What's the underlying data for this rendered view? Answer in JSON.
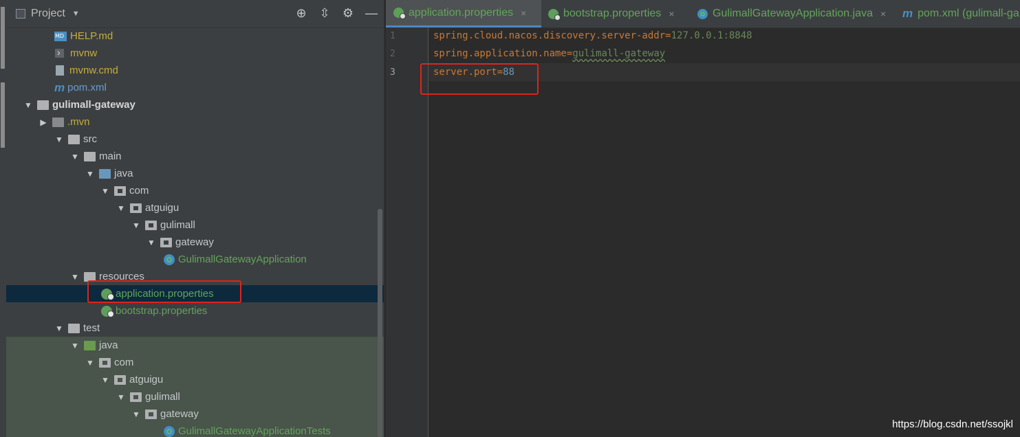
{
  "project_panel": {
    "title": "Project",
    "toolbar_icons": [
      "locate-icon",
      "collapse-icon",
      "gear-icon",
      "minimize-icon"
    ],
    "tree": [
      {
        "label": "HELP.md",
        "icon": "markdown-file-icon"
      },
      {
        "label": "mvnw",
        "icon": "script-file-icon"
      },
      {
        "label": "mvnw.cmd",
        "icon": "text-file-icon"
      },
      {
        "label": "pom.xml",
        "icon": "maven-icon"
      },
      {
        "label": "gulimall-gateway",
        "icon": "module-folder-icon"
      },
      {
        "label": ".mvn",
        "icon": "folder-icon"
      },
      {
        "label": "src",
        "icon": "folder-icon"
      },
      {
        "label": "main",
        "icon": "folder-icon"
      },
      {
        "label": "java",
        "icon": "source-folder-icon"
      },
      {
        "label": "com",
        "icon": "package-icon"
      },
      {
        "label": "atguigu",
        "icon": "package-icon"
      },
      {
        "label": "gulimall",
        "icon": "package-icon"
      },
      {
        "label": "gateway",
        "icon": "package-icon"
      },
      {
        "label": "GulimallGatewayApplication",
        "icon": "spring-boot-class-icon"
      },
      {
        "label": "resources",
        "icon": "resources-folder-icon"
      },
      {
        "label": "application.properties",
        "icon": "spring-properties-icon"
      },
      {
        "label": "bootstrap.properties",
        "icon": "spring-properties-icon"
      },
      {
        "label": "test",
        "icon": "folder-icon"
      },
      {
        "label": "java",
        "icon": "test-source-folder-icon"
      },
      {
        "label": "com",
        "icon": "package-icon"
      },
      {
        "label": "atguigu",
        "icon": "package-icon"
      },
      {
        "label": "gulimall",
        "icon": "package-icon"
      },
      {
        "label": "gateway",
        "icon": "package-icon"
      },
      {
        "label": "GulimallGatewayApplicationTests",
        "icon": "spring-boot-class-icon"
      }
    ]
  },
  "editor": {
    "tabs": [
      {
        "label": "application.properties",
        "icon": "spring-properties-icon",
        "active": true
      },
      {
        "label": "bootstrap.properties",
        "icon": "spring-properties-icon",
        "active": false
      },
      {
        "label": "GulimallGatewayApplication.java",
        "icon": "spring-boot-class-icon",
        "active": false
      },
      {
        "label": "pom.xml (gulimall-ga",
        "icon": "maven-icon",
        "active": false
      }
    ],
    "close_glyph": "×",
    "lines": [
      {
        "number": "1",
        "key": "spring.cloud.nacos.discovery.server-addr",
        "eq": "=",
        "value": "127.0.0.1:8848"
      },
      {
        "number": "2",
        "key": "spring.application.name",
        "eq": "=",
        "value": "gulimall-gateway"
      },
      {
        "number": "3",
        "key": "server.port",
        "eq": "=",
        "value": "88"
      }
    ]
  },
  "watermark": "https://blog.csdn.net/ssojkl",
  "colors": {
    "highlight_box": "#e0231c",
    "selection": "#0d293e",
    "key": "#cc7832",
    "string_value": "#6a8759",
    "number_value": "#6897bb"
  }
}
